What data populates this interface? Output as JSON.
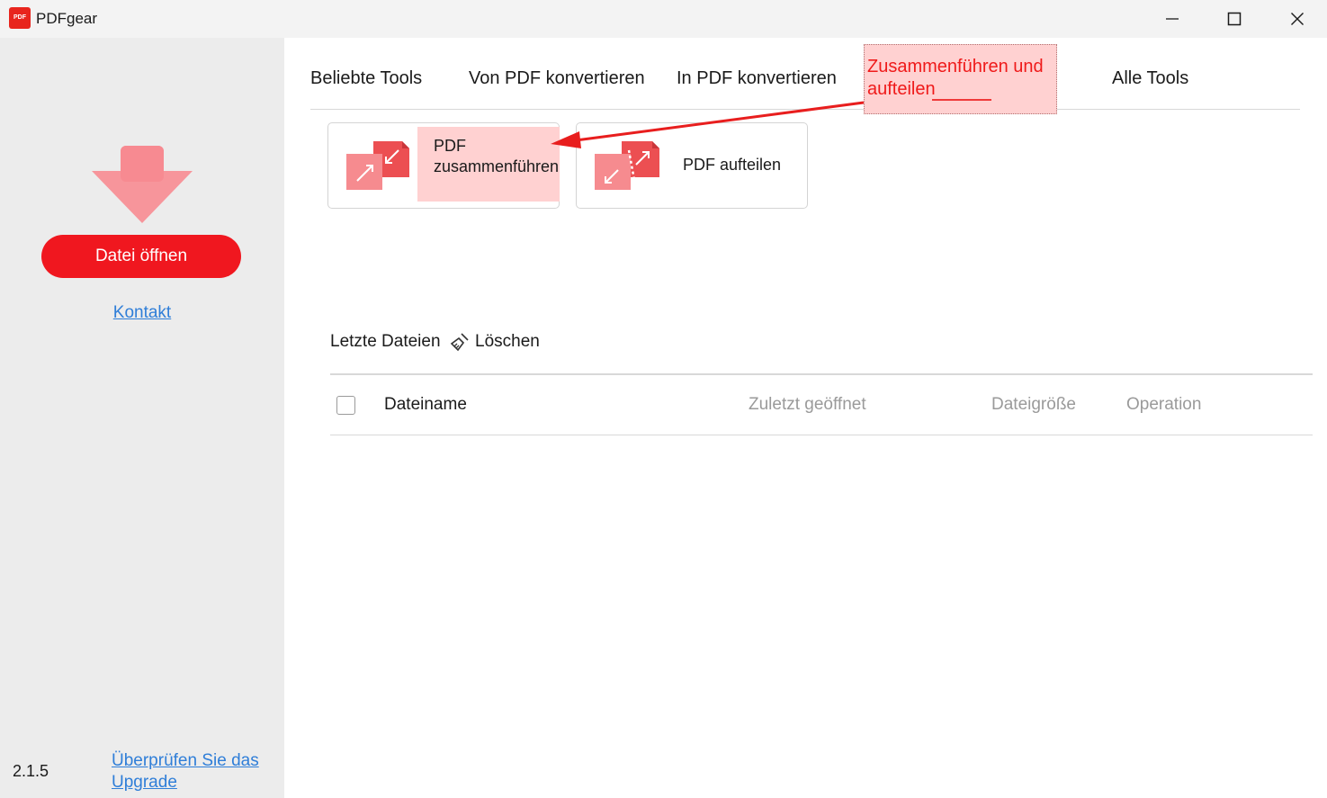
{
  "window": {
    "app_logo_text": "PDF",
    "title": "PDFgear",
    "icons": {
      "minimize": "minimize-icon",
      "maximize": "maximize-icon",
      "close": "close-icon"
    }
  },
  "sidebar": {
    "drop_icon": "file-drop-arrow-icon",
    "open_button": "Datei öffnen",
    "contact_link": "Kontakt",
    "version": "2.1.5",
    "upgrade_link": "Überprüfen Sie das Upgrade"
  },
  "tabs": {
    "beliebte": "Beliebte Tools",
    "von_pdf": "Von PDF konvertieren",
    "in_pdf": "In PDF konvertieren",
    "merge_split": "Zusammenführen und aufteilen",
    "alle": "Alle Tools",
    "active": "Zusammenführen und aufteilen"
  },
  "tools": {
    "merge": {
      "label": "PDF zusammenführen",
      "icon": "merge-pdf-icon"
    },
    "split": {
      "label": "PDF aufteilen",
      "icon": "split-pdf-icon"
    }
  },
  "recent": {
    "title": "Letzte Dateien",
    "clear_label": "Löschen",
    "clear_icon": "broom-icon",
    "columns": {
      "name": "Dateiname",
      "opened": "Zuletzt geöffnet",
      "size": "Dateigröße",
      "operation": "Operation"
    }
  },
  "colors": {
    "accent": "#f0171f",
    "highlight": "#ffd1d1",
    "annotation": "#ef1a1a",
    "link": "#2f7ed8",
    "sidebar_bg": "#ececec"
  }
}
